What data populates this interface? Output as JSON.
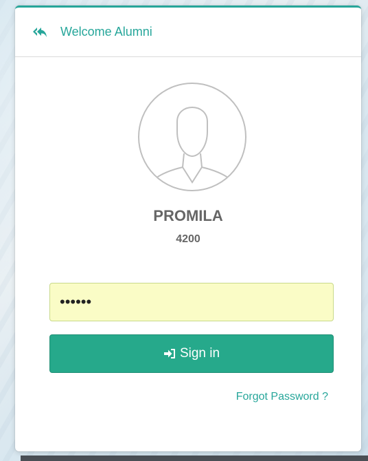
{
  "header": {
    "title": "Welcome Alumni",
    "icon": "reply-all-icon"
  },
  "user": {
    "name": "PROMILA",
    "id": "4200",
    "avatar_icon": "user-avatar-icon"
  },
  "password_field": {
    "value": "••••••"
  },
  "sign_in_button": {
    "label": "Sign in",
    "icon": "sign-in-icon"
  },
  "forgot_password": {
    "label": "Forgot Password ?"
  },
  "colors": {
    "accent": "#26a69a",
    "button": "#26a98b",
    "input_background": "#fafcc6",
    "text_muted": "#666666"
  }
}
